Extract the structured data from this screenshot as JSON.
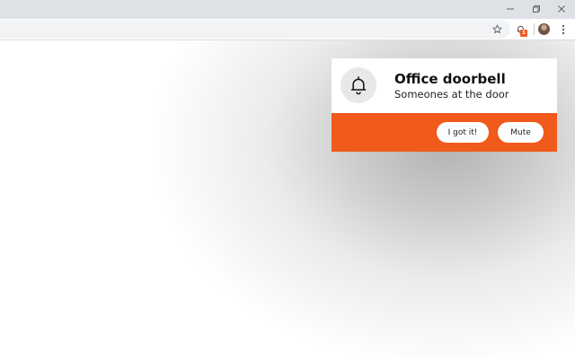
{
  "window": {
    "controls": {
      "minimize_icon": "minimize-icon",
      "restore_icon": "restore-icon",
      "close_icon": "close-icon"
    }
  },
  "toolbar": {
    "icons": [
      "star-icon",
      "bell-extension-icon",
      "avatar",
      "kebab-menu-icon"
    ],
    "extension_badge": "1"
  },
  "notification": {
    "title": "Office doorbell",
    "message": "Someones at the door",
    "icon": "bell-icon",
    "accent_color": "#f05a1a",
    "actions": [
      {
        "label": "I got it!"
      },
      {
        "label": "Mute"
      }
    ]
  }
}
